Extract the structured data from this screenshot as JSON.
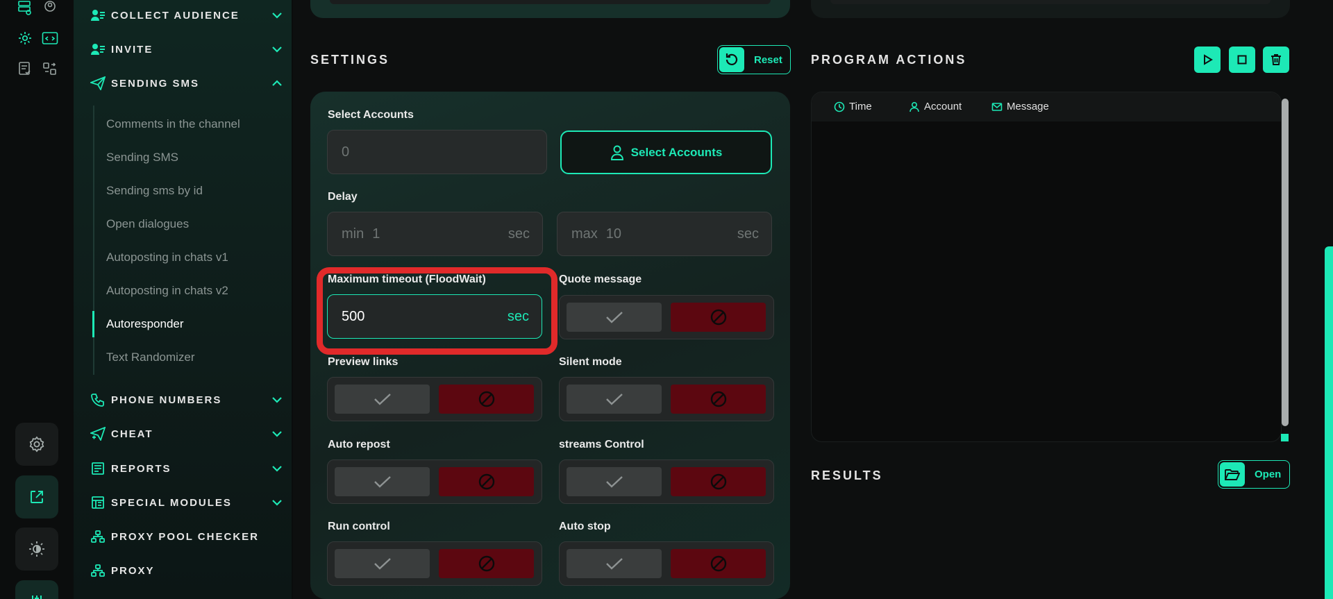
{
  "colors": {
    "accent": "#1de9b6",
    "danger": "#5c0710",
    "highlight": "#e02a2a"
  },
  "rail": {
    "icons": [
      "database-settings-icon",
      "user-circle-icon",
      "gear-icon",
      "code-window-icon",
      "checklist-icon",
      "grid-swap-icon"
    ],
    "buttons": [
      "settings-icon",
      "external-link-icon",
      "theme-toggle-icon",
      "sliders-icon"
    ]
  },
  "sidebar": {
    "groups": [
      {
        "label": "COLLECT AUDIENCE",
        "icon": "user-list-icon",
        "state": "collapsed"
      },
      {
        "label": "INVITE",
        "icon": "user-list-icon",
        "state": "collapsed"
      },
      {
        "label": "SENDING SMS",
        "icon": "send-icon",
        "state": "expanded"
      },
      {
        "label": "PHONE NUMBERS",
        "icon": "phone-icon",
        "state": "collapsed"
      },
      {
        "label": "CHEAT",
        "icon": "send-plus-icon",
        "state": "collapsed"
      },
      {
        "label": "REPORTS",
        "icon": "report-icon",
        "state": "collapsed"
      },
      {
        "label": "SPECIAL MODULES",
        "icon": "modules-icon",
        "state": "collapsed"
      },
      {
        "label": "PROXY POOL CHECKER",
        "icon": "network-icon"
      },
      {
        "label": "PROXY",
        "icon": "network-icon"
      }
    ],
    "sub_items": [
      {
        "label": "Comments in the channel"
      },
      {
        "label": "Sending SMS"
      },
      {
        "label": "Sending sms by id"
      },
      {
        "label": "Open dialogues"
      },
      {
        "label": "Autoposting in chats v1"
      },
      {
        "label": "Autoposting in chats v2"
      },
      {
        "label": "Autoresponder",
        "active": true
      },
      {
        "label": "Text Randomizer"
      }
    ]
  },
  "settings": {
    "title": "SETTINGS",
    "reset_label": "Reset",
    "select_accounts_label": "Select Accounts",
    "accounts_count": "0",
    "select_accounts_button": "Select Accounts",
    "delay_label": "Delay",
    "delay_min_prefix": "min",
    "delay_min_value": "1",
    "delay_max_prefix": "max",
    "delay_max_value": "10",
    "sec_unit": "sec",
    "timeout_label": "Maximum timeout (FloodWait)",
    "timeout_value": "500",
    "toggles": {
      "quote_message": "Quote message",
      "preview_links": "Preview links",
      "silent_mode": "Silent mode",
      "auto_repost": "Auto repost",
      "streams_control": "streams Control",
      "run_control": "Run control",
      "auto_stop": "Auto stop"
    }
  },
  "program_actions": {
    "title": "PROGRAM ACTIONS",
    "columns": [
      "Time",
      "Account",
      "Message"
    ]
  },
  "results": {
    "title": "RESULTS",
    "open_label": "Open"
  }
}
